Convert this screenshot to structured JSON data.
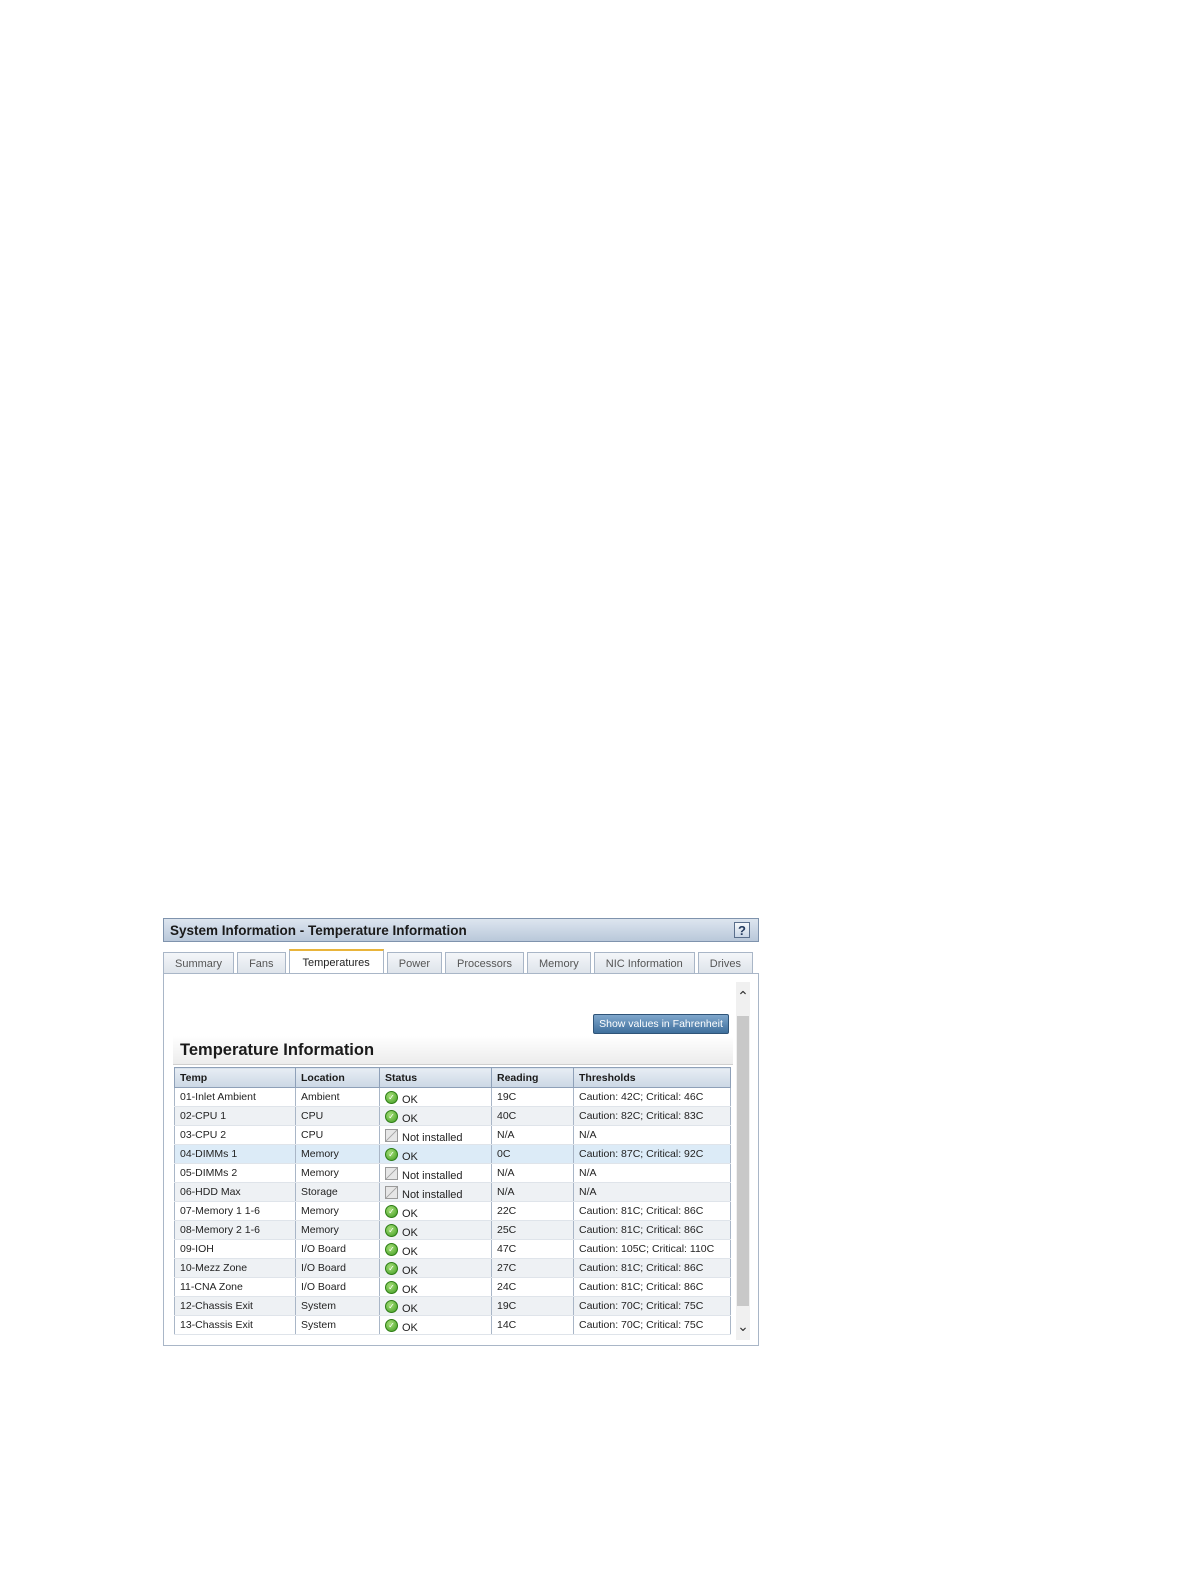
{
  "window": {
    "title": "System Information - Temperature Information",
    "help_label": "?"
  },
  "tabs": [
    {
      "label": "Summary",
      "active": false
    },
    {
      "label": "Fans",
      "active": false
    },
    {
      "label": "Temperatures",
      "active": true
    },
    {
      "label": "Power",
      "active": false
    },
    {
      "label": "Processors",
      "active": false
    },
    {
      "label": "Memory",
      "active": false
    },
    {
      "label": "NIC Information",
      "active": false
    },
    {
      "label": "Drives",
      "active": false
    }
  ],
  "toolbar": {
    "fahrenheit_label": "Show values in Fahrenheit"
  },
  "section": {
    "title": "Temperature Information"
  },
  "table": {
    "columns": [
      "Temp",
      "Location",
      "Status",
      "Reading",
      "Thresholds"
    ],
    "rows": [
      {
        "temp": "01-Inlet Ambient",
        "location": "Ambient",
        "status": "OK",
        "status_icon": "ok-icon",
        "reading": "19C",
        "thresholds": "Caution: 42C; Critical: 46C"
      },
      {
        "temp": "02-CPU 1",
        "location": "CPU",
        "status": "OK",
        "status_icon": "ok-icon",
        "reading": "40C",
        "thresholds": "Caution: 82C; Critical: 83C"
      },
      {
        "temp": "03-CPU 2",
        "location": "CPU",
        "status": "Not installed",
        "status_icon": "not-installed-icon",
        "reading": "N/A",
        "thresholds": "N/A"
      },
      {
        "temp": "04-DIMMs 1",
        "location": "Memory",
        "status": "OK",
        "status_icon": "ok-icon",
        "reading": "0C",
        "thresholds": "Caution: 87C; Critical: 92C"
      },
      {
        "temp": "05-DIMMs 2",
        "location": "Memory",
        "status": "Not installed",
        "status_icon": "not-installed-icon",
        "reading": "N/A",
        "thresholds": "N/A"
      },
      {
        "temp": "06-HDD Max",
        "location": "Storage",
        "status": "Not installed",
        "status_icon": "not-installed-icon",
        "reading": "N/A",
        "thresholds": "N/A"
      },
      {
        "temp": "07-Memory 1 1-6",
        "location": "Memory",
        "status": "OK",
        "status_icon": "ok-icon",
        "reading": "22C",
        "thresholds": "Caution: 81C; Critical: 86C"
      },
      {
        "temp": "08-Memory 2 1-6",
        "location": "Memory",
        "status": "OK",
        "status_icon": "ok-icon",
        "reading": "25C",
        "thresholds": "Caution: 81C; Critical: 86C"
      },
      {
        "temp": "09-IOH",
        "location": "I/O Board",
        "status": "OK",
        "status_icon": "ok-icon",
        "reading": "47C",
        "thresholds": "Caution: 105C; Critical: 110C"
      },
      {
        "temp": "10-Mezz Zone",
        "location": "I/O Board",
        "status": "OK",
        "status_icon": "ok-icon",
        "reading": "27C",
        "thresholds": "Caution: 81C; Critical: 86C"
      },
      {
        "temp": "11-CNA Zone",
        "location": "I/O Board",
        "status": "OK",
        "status_icon": "ok-icon",
        "reading": "24C",
        "thresholds": "Caution: 81C; Critical: 86C"
      },
      {
        "temp": "12-Chassis Exit",
        "location": "System",
        "status": "OK",
        "status_icon": "ok-icon",
        "reading": "19C",
        "thresholds": "Caution: 70C; Critical: 75C"
      },
      {
        "temp": "13-Chassis Exit",
        "location": "System",
        "status": "OK",
        "status_icon": "ok-icon",
        "reading": "14C",
        "thresholds": "Caution: 70C; Critical: 75C"
      }
    ]
  },
  "colors": {
    "accent_tab": "#e9b43a",
    "button_bg": "#3f6f9c",
    "ok_green": "#3d9b1f",
    "highlight_row": "#dcebf7"
  }
}
